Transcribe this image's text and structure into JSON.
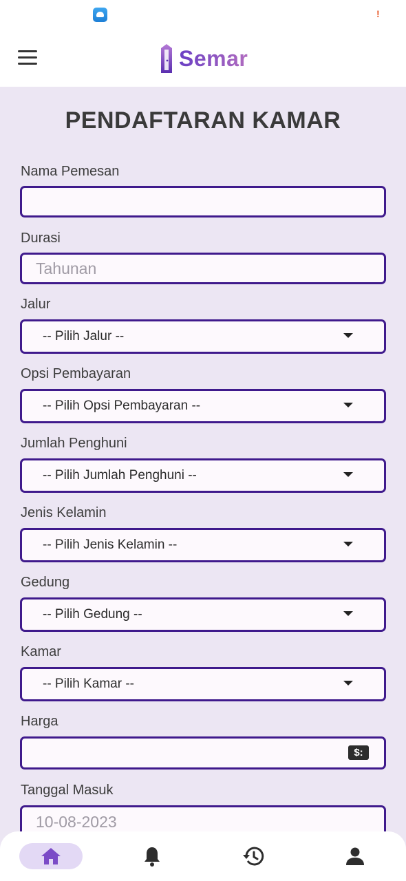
{
  "status_bar": {
    "app_icon": "cloud-upload-icon",
    "alert_glyph": "!"
  },
  "app_bar": {
    "menu_icon": "hamburger-menu-icon",
    "logo_text": "Semar"
  },
  "form": {
    "title": "PENDAFTARAN KAMAR",
    "fields": {
      "nama_pemesan": {
        "label": "Nama Pemesan",
        "value": ""
      },
      "durasi": {
        "label": "Durasi",
        "placeholder": "Tahunan"
      },
      "jalur": {
        "label": "Jalur",
        "selected": "-- Pilih Jalur --"
      },
      "opsi_pembayaran": {
        "label": "Opsi Pembayaran",
        "selected": "-- Pilih Opsi Pembayaran --"
      },
      "jumlah_penghuni": {
        "label": "Jumlah Penghuni",
        "selected": "-- Pilih Jumlah Penghuni --"
      },
      "jenis_kelamin": {
        "label": "Jenis Kelamin",
        "selected": "-- Pilih Jenis Kelamin --"
      },
      "gedung": {
        "label": "Gedung",
        "selected": "-- Pilih Gedung --"
      },
      "kamar": {
        "label": "Kamar",
        "selected": "-- Pilih Kamar --"
      },
      "harga": {
        "label": "Harga",
        "value": "",
        "icon": "money-icon"
      },
      "tanggal_masuk": {
        "label": "Tanggal Masuk",
        "placeholder": "10-08-2023"
      }
    }
  },
  "bottom_nav": {
    "items": [
      {
        "icon": "home-icon",
        "active": true
      },
      {
        "icon": "bell-icon",
        "active": false
      },
      {
        "icon": "history-icon",
        "active": false
      },
      {
        "icon": "profile-icon",
        "active": false
      }
    ]
  },
  "colors": {
    "accent": "#3f1a8c",
    "background": "#ece6f3",
    "logo": "#7b4bc7",
    "active_nav": "#7b4bc7"
  }
}
